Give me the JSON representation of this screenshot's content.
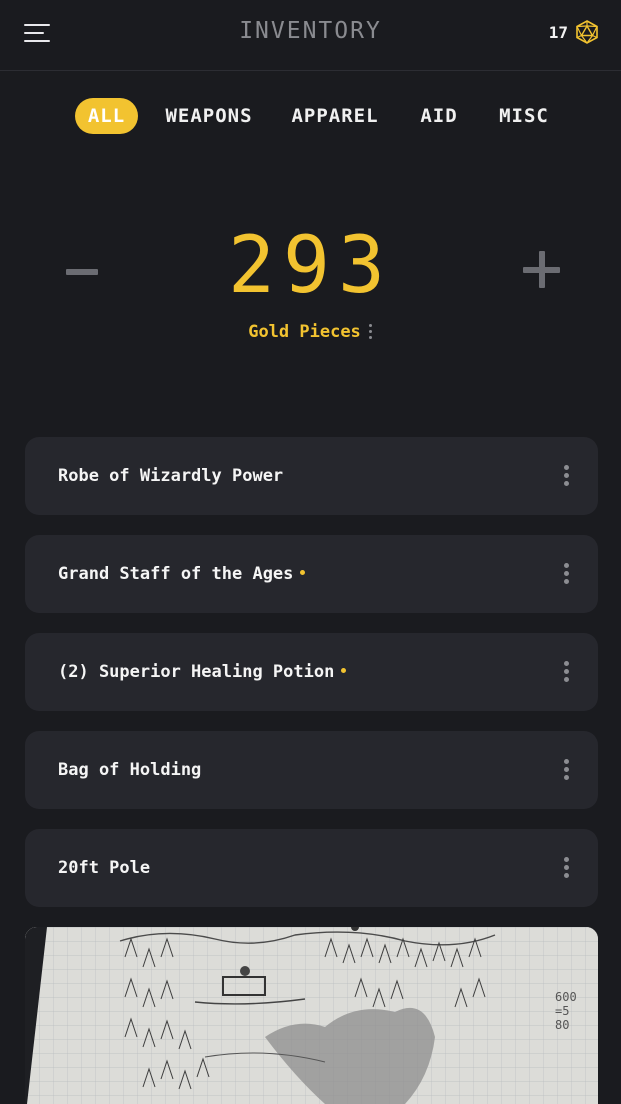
{
  "header": {
    "title": "INVENTORY",
    "level": "17",
    "menu_icon": "hamburger-menu-icon",
    "level_icon": "d20-icon"
  },
  "tabs": [
    {
      "label": "ALL",
      "active": true
    },
    {
      "label": "WEAPONS",
      "active": false
    },
    {
      "label": "APPAREL",
      "active": false
    },
    {
      "label": "AID",
      "active": false
    },
    {
      "label": "MISC",
      "active": false
    }
  ],
  "gold": {
    "value": "293",
    "label": "Gold Pieces"
  },
  "items": [
    {
      "name": "Robe of Wizardly Power",
      "marked": false
    },
    {
      "name": "Grand Staff of the Ages",
      "marked": true
    },
    {
      "name": "(2) Superior Healing Potion",
      "marked": true
    },
    {
      "name": "Bag of Holding",
      "marked": false
    },
    {
      "name": "20ft Pole",
      "marked": false
    }
  ],
  "map_image": {
    "description_icon": "hand-drawn-map-image",
    "note_text": [
      "600",
      "=5",
      "80"
    ]
  },
  "colors": {
    "accent": "#f2c330",
    "background": "#1a1b1f",
    "card": "#26272d",
    "muted": "#6b6c72"
  }
}
